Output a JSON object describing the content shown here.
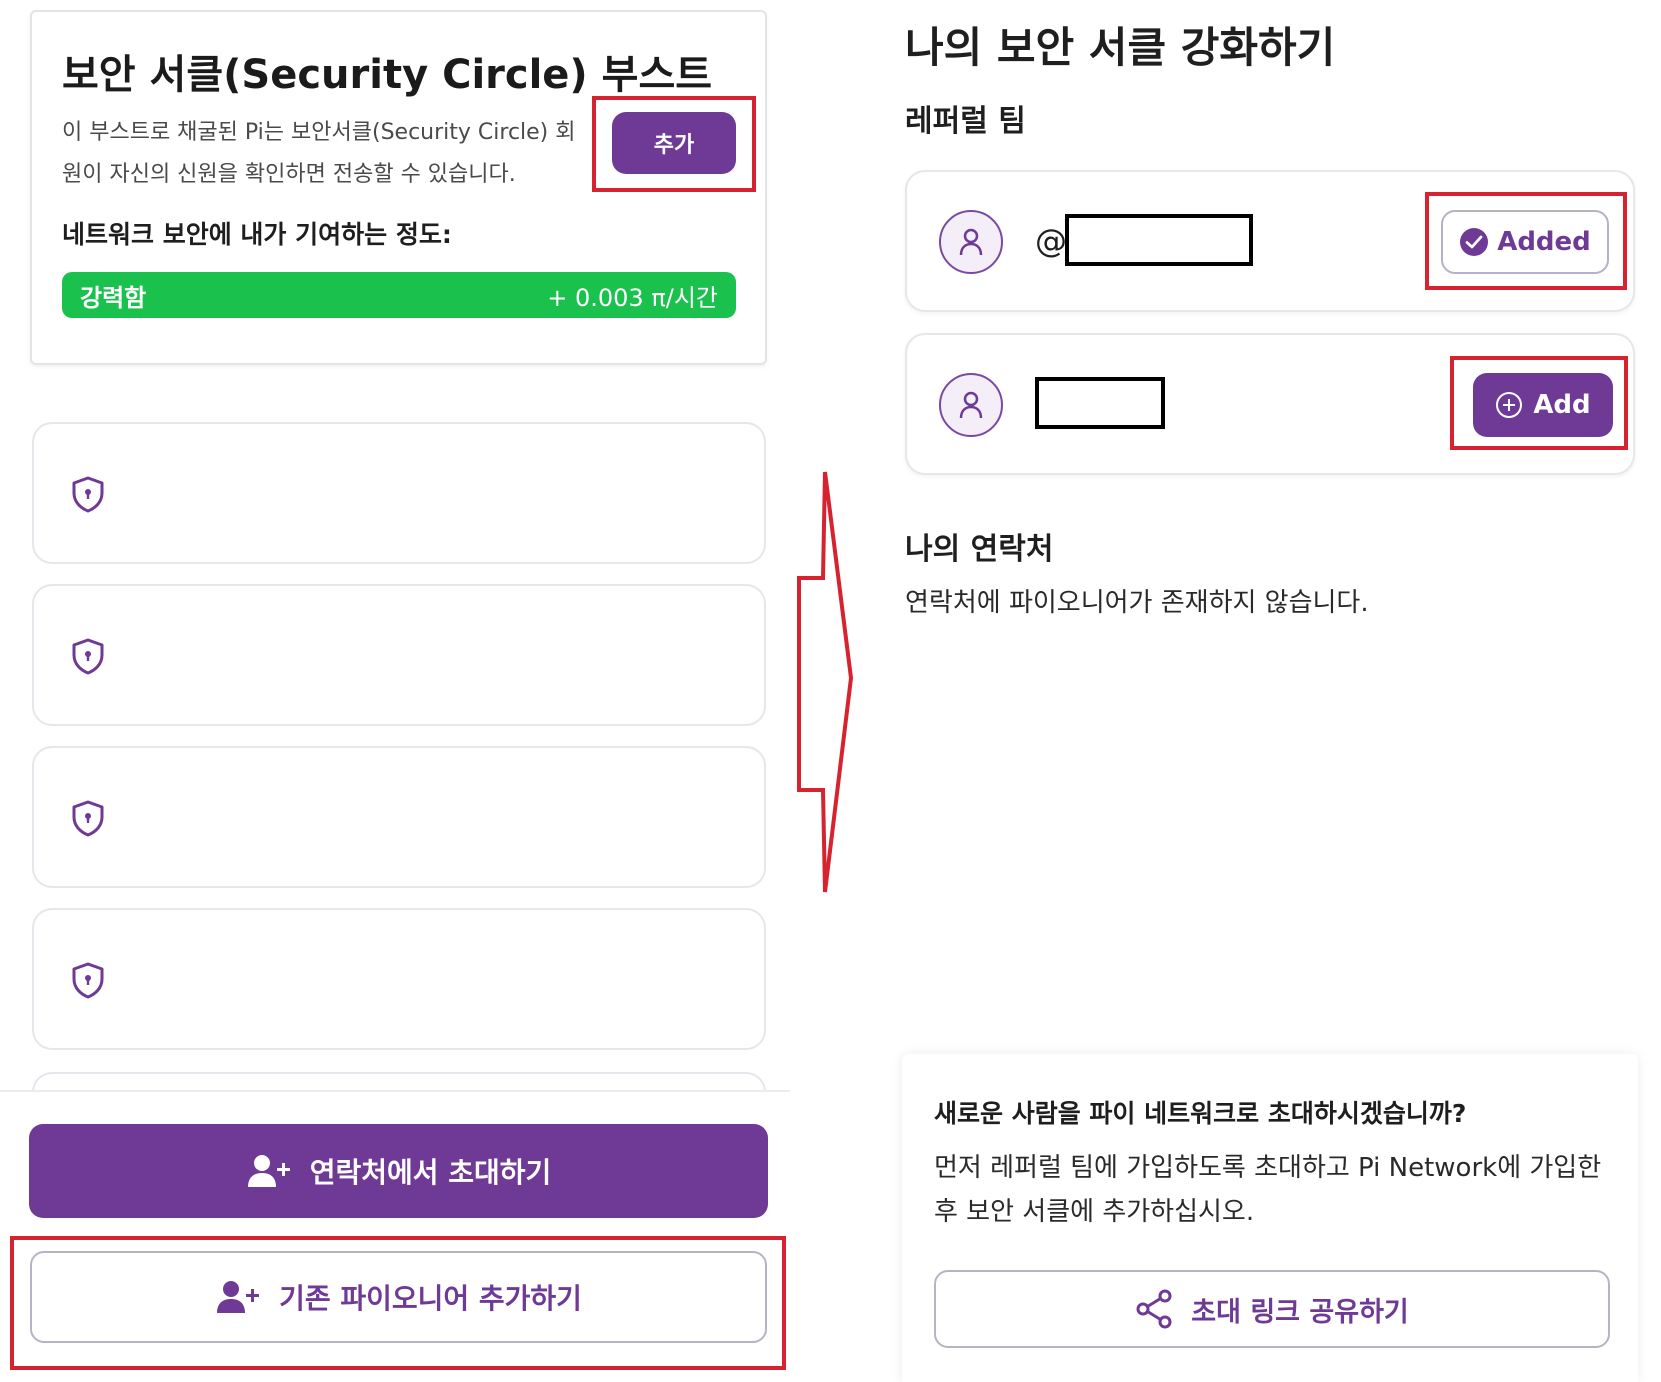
{
  "left": {
    "boost": {
      "title": "보안 서클(Security Circle) 부스트",
      "description": "이 부스트로 채굴된 Pi는 보안서클(Security Circle) 회원이 자신의 신원을 확인하면 전송할 수 있습니다.",
      "add_label": "추가",
      "contribution_label": "네트워크 보안에 내가 기여하는 정도:",
      "strength_level": "강력함",
      "rate": "+ 0.003 π/시간"
    },
    "slots": [
      {
        "icon": "shield-lock-icon"
      },
      {
        "icon": "shield-lock-icon"
      },
      {
        "icon": "shield-lock-icon"
      },
      {
        "icon": "shield-lock-icon"
      }
    ],
    "buttons": {
      "invite_contacts": "연락처에서 초대하기",
      "add_existing": "기존 파이오니어 추가하기"
    }
  },
  "right": {
    "title": "나의 보안 서클 강화하기",
    "referral_team_title": "레퍼럴 팀",
    "members": [
      {
        "prefix": "@",
        "name": "",
        "status": "Added"
      },
      {
        "prefix": "",
        "name": "",
        "status": "Add"
      }
    ],
    "contacts_title": "나의 연락처",
    "contacts_empty": "연락처에 파이오니어가 존재하지 않습니다.",
    "invite": {
      "question": "새로운 사람을 파이 네트워크로 초대하시겠습니까?",
      "description": "먼저 레퍼럴 팀에 가입하도록 초대하고 Pi Network에 가입한 후 보안 서클에 추가하십시오.",
      "share_label": "초대 링크 공유하기"
    }
  },
  "colors": {
    "purple": "#6f3a96",
    "green": "#1ac24d",
    "annotation_red": "#d7232f"
  }
}
